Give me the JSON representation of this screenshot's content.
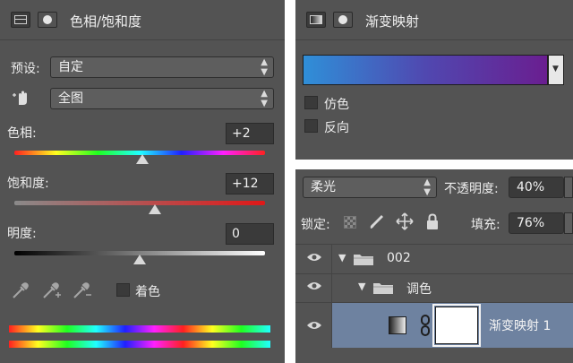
{
  "hue_sat_panel": {
    "title": "色相/饱和度",
    "preset_label": "预设:",
    "preset_value": "自定",
    "range_value": "全图",
    "hue_label": "色相:",
    "hue_value": "+2",
    "sat_label": "饱和度:",
    "sat_value": "+12",
    "light_label": "明度:",
    "light_value": "0",
    "colorize_label": "着色",
    "hue_level": 0.51,
    "sat_level": 0.56,
    "light_level": 0.5
  },
  "gradient_map_panel": {
    "title": "渐变映射",
    "gradient_colors": [
      "#2f8fd8",
      "#5048b0",
      "#6a1e90"
    ],
    "dither_label": "仿色",
    "reverse_label": "反向"
  },
  "layers_panel": {
    "blend_mode": "柔光",
    "opacity_label": "不透明度:",
    "opacity_value": "40%",
    "lock_label": "锁定:",
    "fill_label": "填充:",
    "fill_value": "76%",
    "layers": [
      {
        "name": "002"
      },
      {
        "name": "调色"
      },
      {
        "name": "渐变映射 1"
      }
    ]
  }
}
